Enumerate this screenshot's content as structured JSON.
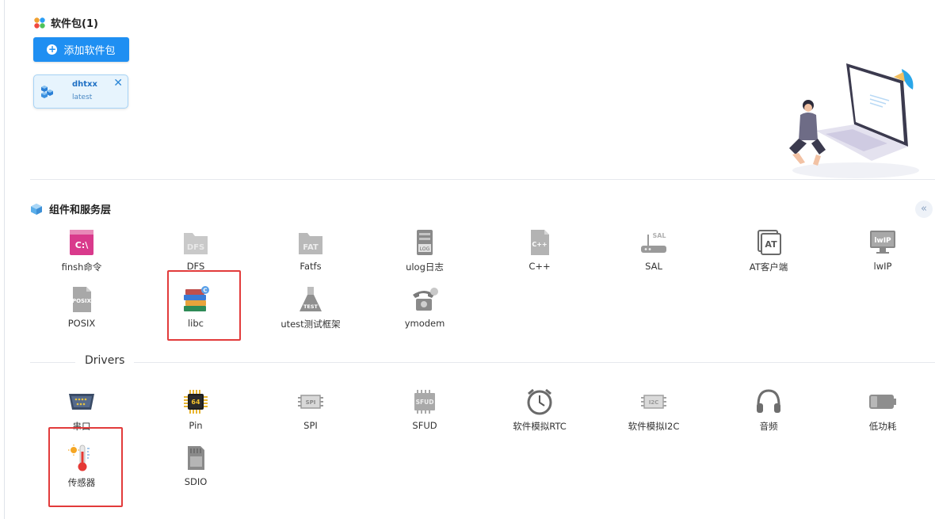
{
  "packages": {
    "title": "软件包(1)",
    "add_button": "添加软件包",
    "installed": [
      {
        "name": "dhtxx",
        "version": "latest"
      }
    ]
  },
  "components": {
    "title": "组件和服务层",
    "collapse_glyph": "«",
    "items": [
      {
        "label": "finsh命令",
        "icon": "terminal-icon"
      },
      {
        "label": "DFS",
        "icon": "folder-icon"
      },
      {
        "label": "Fatfs",
        "icon": "folder-icon"
      },
      {
        "label": "ulog日志",
        "icon": "log-file-icon"
      },
      {
        "label": "C++",
        "icon": "cpp-file-icon"
      },
      {
        "label": "SAL",
        "icon": "router-icon"
      },
      {
        "label": "AT客户端",
        "icon": "at-command-icon"
      },
      {
        "label": "lwIP",
        "icon": "monitor-icon"
      },
      {
        "label": "POSIX",
        "icon": "posix-file-icon"
      },
      {
        "label": "libc",
        "icon": "books-icon"
      },
      {
        "label": "utest测试框架",
        "icon": "flask-icon"
      },
      {
        "label": "ymodem",
        "icon": "telephone-icon"
      }
    ]
  },
  "drivers": {
    "title": "Drivers",
    "items": [
      {
        "label": "串口",
        "icon": "serial-port-icon"
      },
      {
        "label": "Pin",
        "icon": "chip-icon"
      },
      {
        "label": "SPI",
        "icon": "spi-bus-icon"
      },
      {
        "label": "SFUD",
        "icon": "flash-chip-icon"
      },
      {
        "label": "软件模拟RTC",
        "icon": "clock-icon"
      },
      {
        "label": "软件模拟I2C",
        "icon": "i2c-bus-icon"
      },
      {
        "label": "音频",
        "icon": "headphones-icon"
      },
      {
        "label": "低功耗",
        "icon": "battery-icon"
      },
      {
        "label": "传感器",
        "icon": "thermometer-icon"
      },
      {
        "label": "SDIO",
        "icon": "sd-card-icon"
      }
    ]
  },
  "colors": {
    "accent": "#1f8ff2",
    "highlight_box": "#e23b3b"
  }
}
